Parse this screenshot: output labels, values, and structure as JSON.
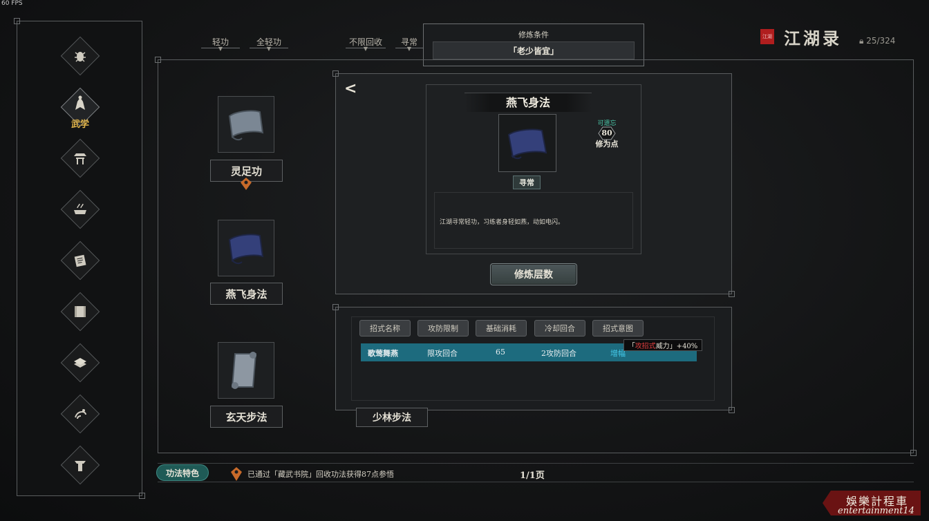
{
  "fps": "60 FPS",
  "sidebar": {
    "items": [
      {
        "icon": "bug-icon",
        "label": ""
      },
      {
        "icon": "martial-figure-icon",
        "label": "武学"
      },
      {
        "icon": "pavilion-icon",
        "label": ""
      },
      {
        "icon": "cooking-pot-icon",
        "label": ""
      },
      {
        "icon": "scroll-book-icon",
        "label": ""
      },
      {
        "icon": "parchment-icon",
        "label": ""
      },
      {
        "icon": "stacked-books-icon",
        "label": ""
      },
      {
        "icon": "horse-icon",
        "label": ""
      },
      {
        "icon": "robe-icon",
        "label": ""
      }
    ]
  },
  "filters": [
    "轻功",
    "全轻功",
    "不限回收",
    "寻常"
  ],
  "condition": {
    "title": "修炼条件",
    "value": "「老少皆宜」"
  },
  "header": {
    "title": "江湖录",
    "seal": "江湖",
    "count": "25/324"
  },
  "skills": [
    {
      "name": "灵足功"
    },
    {
      "name": "燕飞身法"
    },
    {
      "name": "玄天步法"
    }
  ],
  "detail": {
    "name": "燕飞身法",
    "quality": "寻常",
    "forget_label": "可遗忘",
    "forget_value": "80",
    "forget_unit": "修为点",
    "description": "江湖寻常轻功，习练者身轻如燕，动如电闪。",
    "train_button": "修炼层数"
  },
  "moves": {
    "headers": [
      "招式名称",
      "攻防限制",
      "基础消耗",
      "冷却回合",
      "招式意图"
    ],
    "rows": [
      {
        "name": "歌莺舞燕",
        "limit": "限攻回合",
        "cost": "65",
        "cooldown": "2攻防回合",
        "intent": "增幅"
      }
    ],
    "tooltip_pre": "「",
    "tooltip_red": "攻招式",
    "tooltip_post": "威力」+40%"
  },
  "extra_skill": "少林步法",
  "footer": {
    "feature_button": "功法特色",
    "notice": "已通过「藏武书院」回收功法获得87点参悟",
    "pages": "1/1页"
  },
  "watermark": {
    "zh": "娛樂計程車",
    "en": "entertainment14"
  },
  "colors": {
    "accent_gold": "#e2b54a",
    "row_teal": "#1d6b7e",
    "forget_green": "#4ac6a8",
    "seal_red": "#b01e1e"
  }
}
